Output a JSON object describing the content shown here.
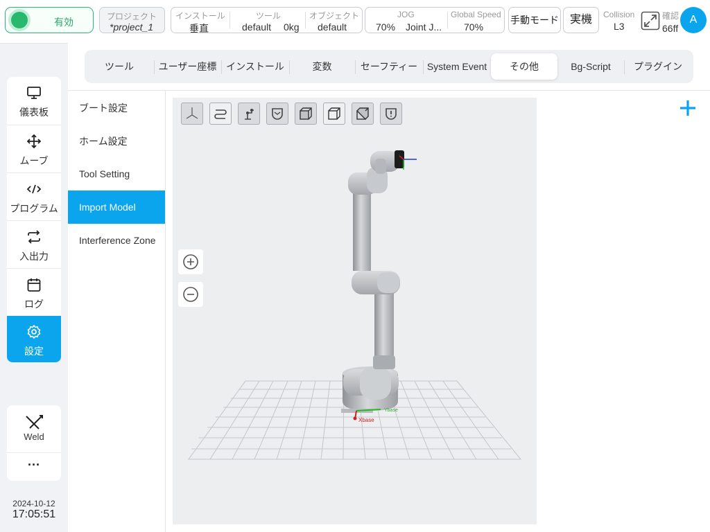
{
  "topbar": {
    "enable_label": "有効",
    "project": {
      "label": "プロジェクト",
      "value": "*project_1"
    },
    "install": {
      "label": "インストール",
      "value": "垂直"
    },
    "tool": {
      "label": "ツール",
      "value": "default",
      "weight": "0kg"
    },
    "object": {
      "label": "オブジェクト",
      "value": "default"
    },
    "jog": {
      "label": "JOG",
      "percent": "70%",
      "mode": "Joint J..."
    },
    "global_speed": {
      "label": "Global Speed",
      "value": "70%"
    },
    "manual_mode": "手動モード",
    "real_machine": "実機",
    "collision": {
      "label": "Collision",
      "value": "L3"
    },
    "confirm": {
      "label": "確認",
      "value": "66ff"
    },
    "avatar": "A"
  },
  "nav": {
    "items": [
      {
        "label": "儀表板",
        "icon": "monitor-icon"
      },
      {
        "label": "ムーブ",
        "icon": "move-arrows-icon"
      },
      {
        "label": "プログラム",
        "icon": "code-icon"
      },
      {
        "label": "入出力",
        "icon": "swap-icon"
      },
      {
        "label": "ログ",
        "icon": "calendar-icon"
      },
      {
        "label": "設定",
        "icon": "gear-icon",
        "active": true
      }
    ],
    "weld": "Weld",
    "more": "···"
  },
  "datetime": {
    "date": "2024-10-12",
    "time": "17:05:51"
  },
  "tabs": [
    {
      "label": "ツール"
    },
    {
      "label": "ユーザー座標"
    },
    {
      "label": "インストール"
    },
    {
      "label": "変数"
    },
    {
      "label": "セーフティー"
    },
    {
      "label": "System Event"
    },
    {
      "label": "その他",
      "active": true
    },
    {
      "label": "Bg-Script"
    },
    {
      "label": "プラグイン"
    }
  ],
  "subnav": [
    {
      "label": "ブート設定"
    },
    {
      "label": "ホーム設定"
    },
    {
      "label": "Tool Setting"
    },
    {
      "label": "Import Model",
      "active": true
    },
    {
      "label": "Interference Zone"
    }
  ],
  "viewer": {
    "toolbar_icons": [
      "axes-view-icon",
      "path-icon",
      "robot-arm-icon",
      "shield-icon",
      "cube-front-icon",
      "cube-side-icon",
      "cube-top-icon",
      "safety-alert-icon"
    ],
    "base_frame_x": "Xbase",
    "base_frame_y": "Ybase"
  },
  "colors": {
    "accent": "#0ba5ee",
    "enabled": "#29b96e"
  }
}
